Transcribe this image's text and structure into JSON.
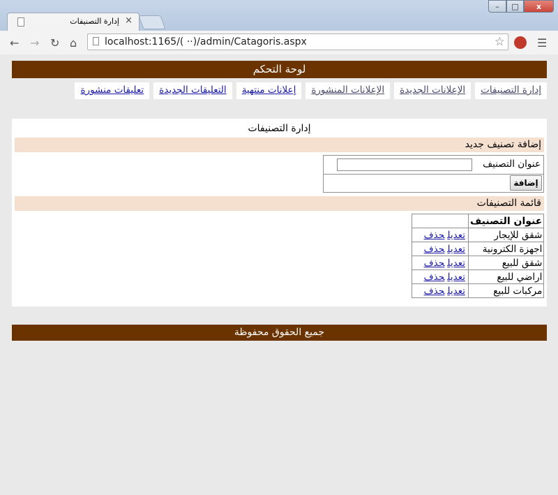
{
  "browser": {
    "tab_title": "إدارة التصنيفات",
    "tab_close": "×",
    "url": "localhost:1165/(  ··)/admin/Catagoris.aspx",
    "window_buttons": {
      "minimize": "–",
      "maximize": "□",
      "close": "x"
    }
  },
  "page": {
    "header": "لوحة التحكم",
    "nav": [
      {
        "label": "إدارة التصنيفات"
      },
      {
        "label": "الإعلانات الجديدة"
      },
      {
        "label": "الإعلانات المنشورة"
      },
      {
        "label": "إعلانات منتهية"
      },
      {
        "label": "التعليقات الجديدة"
      },
      {
        "label": "تعليقات منشورة"
      }
    ],
    "section_title": "إدارة التصنيفات",
    "add_section": {
      "heading": "إضافة تصنيف جديد",
      "field_label": "عنوان التصنيف",
      "field_value": "",
      "button_label": "إضافة"
    },
    "list_section": {
      "heading": "قائمة التصنيفات",
      "column_header": "عنوان التصنيف",
      "edit_label": "تعديل",
      "delete_label": "حذف",
      "rows": [
        {
          "name": "شقق للإيجار"
        },
        {
          "name": "اجهزة الكترونية"
        },
        {
          "name": "شقق للبيع"
        },
        {
          "name": "اراضي للبيع"
        },
        {
          "name": "مركبات للبيع"
        }
      ]
    },
    "footer": "جميع الحقوق محفوظة"
  }
}
